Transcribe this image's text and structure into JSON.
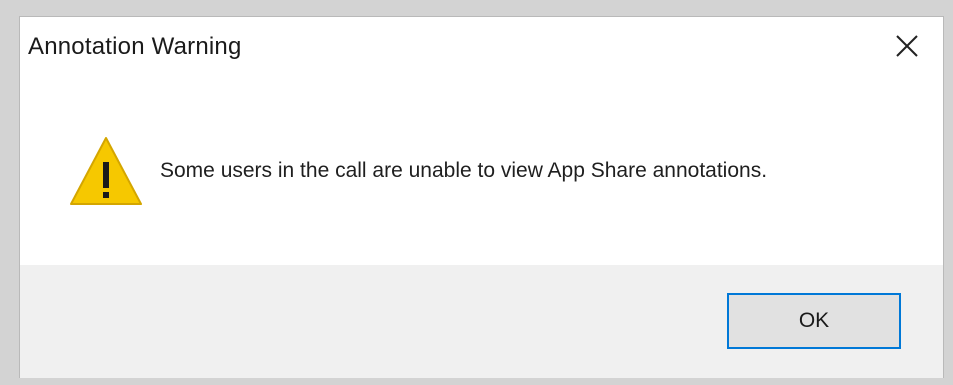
{
  "dialog": {
    "title": "Annotation Warning",
    "close_icon": "close-icon",
    "warning_icon": "warning-icon",
    "message": "Some users in the call are unable to view App Share annotations.",
    "ok_label": "OK"
  },
  "colors": {
    "warning_fill": "#f6c800",
    "accent_border": "#0078d7",
    "footer_bg": "#f0f0f0"
  }
}
